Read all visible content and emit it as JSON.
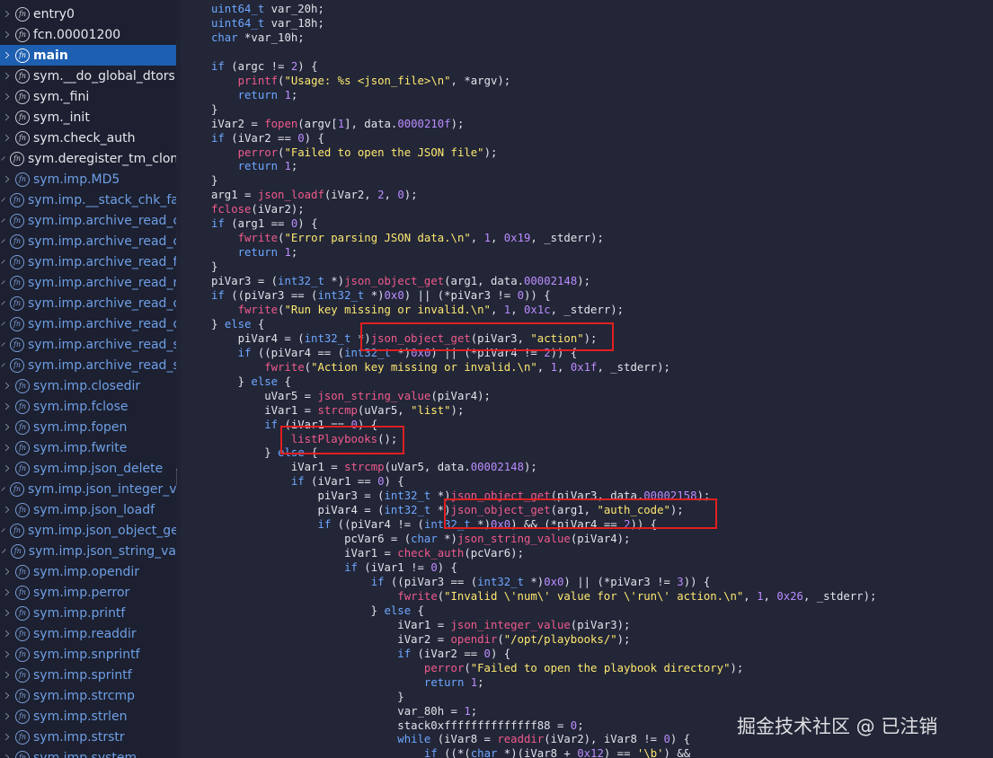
{
  "sidebar": {
    "items": [
      {
        "label": "entry0",
        "imported": false,
        "selected": false
      },
      {
        "label": "fcn.00001200",
        "imported": false,
        "selected": false
      },
      {
        "label": "main",
        "imported": false,
        "selected": true
      },
      {
        "label": "sym.__do_global_dtors",
        "imported": false,
        "selected": false
      },
      {
        "label": "sym._fini",
        "imported": false,
        "selected": false
      },
      {
        "label": "sym._init",
        "imported": false,
        "selected": false
      },
      {
        "label": "sym.check_auth",
        "imported": false,
        "selected": false
      },
      {
        "label": "sym.deregister_tm_clon",
        "imported": false,
        "selected": false
      },
      {
        "label": "sym.imp.MD5",
        "imported": true,
        "selected": false
      },
      {
        "label": "sym.imp.__stack_chk_fa",
        "imported": true,
        "selected": false
      },
      {
        "label": "sym.imp.archive_read_c",
        "imported": true,
        "selected": false
      },
      {
        "label": "sym.imp.archive_read_c",
        "imported": true,
        "selected": false
      },
      {
        "label": "sym.imp.archive_read_f",
        "imported": true,
        "selected": false
      },
      {
        "label": "sym.imp.archive_read_n",
        "imported": true,
        "selected": false
      },
      {
        "label": "sym.imp.archive_read_o",
        "imported": true,
        "selected": false
      },
      {
        "label": "sym.imp.archive_read_d",
        "imported": true,
        "selected": false
      },
      {
        "label": "sym.imp.archive_read_s",
        "imported": true,
        "selected": false
      },
      {
        "label": "sym.imp.archive_read_s",
        "imported": true,
        "selected": false
      },
      {
        "label": "sym.imp.closedir",
        "imported": true,
        "selected": false
      },
      {
        "label": "sym.imp.fclose",
        "imported": true,
        "selected": false
      },
      {
        "label": "sym.imp.fopen",
        "imported": true,
        "selected": false
      },
      {
        "label": "sym.imp.fwrite",
        "imported": true,
        "selected": false
      },
      {
        "label": "sym.imp.json_delete",
        "imported": true,
        "selected": false
      },
      {
        "label": "sym.imp.json_integer_v",
        "imported": true,
        "selected": false
      },
      {
        "label": "sym.imp.json_loadf",
        "imported": true,
        "selected": false
      },
      {
        "label": "sym.imp.json_object_ge",
        "imported": true,
        "selected": false
      },
      {
        "label": "sym.imp.json_string_va",
        "imported": true,
        "selected": false
      },
      {
        "label": "sym.imp.opendir",
        "imported": true,
        "selected": false
      },
      {
        "label": "sym.imp.perror",
        "imported": true,
        "selected": false
      },
      {
        "label": "sym.imp.printf",
        "imported": true,
        "selected": false
      },
      {
        "label": "sym.imp.readdir",
        "imported": true,
        "selected": false
      },
      {
        "label": "sym.imp.snprintf",
        "imported": true,
        "selected": false
      },
      {
        "label": "sym.imp.sprintf",
        "imported": true,
        "selected": false
      },
      {
        "label": "sym.imp.strcmp",
        "imported": true,
        "selected": false
      },
      {
        "label": "sym.imp.strlen",
        "imported": true,
        "selected": false
      },
      {
        "label": "sym.imp.strstr",
        "imported": true,
        "selected": false
      },
      {
        "label": "sym.imp.system",
        "imported": true,
        "selected": false
      }
    ]
  },
  "code": {
    "lines": [
      [
        [
          "uint64_t",
          "dt"
        ],
        [
          " var_20h;",
          ""
        ]
      ],
      [
        [
          "uint64_t",
          "dt"
        ],
        [
          " var_18h;",
          ""
        ]
      ],
      [
        [
          "char",
          "dt"
        ],
        [
          " *var_10h;",
          ""
        ]
      ],
      [],
      [
        [
          "if",
          "kw"
        ],
        [
          " (argc != ",
          ""
        ],
        [
          "2",
          "num"
        ],
        [
          ") {",
          ""
        ]
      ],
      [
        [
          "    ",
          ""
        ],
        [
          "printf",
          "fn"
        ],
        [
          "(",
          ""
        ],
        [
          "\"Usage: %s <json_file>\\n\"",
          "str"
        ],
        [
          ", *argv);",
          ""
        ]
      ],
      [
        [
          "    ",
          ""
        ],
        [
          "return",
          "kw"
        ],
        [
          " ",
          ""
        ],
        [
          "1",
          "num"
        ],
        [
          ";",
          ""
        ]
      ],
      [
        [
          "}",
          ""
        ]
      ],
      [
        [
          "iVar2 = ",
          ""
        ],
        [
          "fopen",
          "fn"
        ],
        [
          "(argv[",
          ""
        ],
        [
          "1",
          "num"
        ],
        [
          "], data.",
          ""
        ],
        [
          "0000210f",
          "num"
        ],
        [
          ");",
          ""
        ]
      ],
      [
        [
          "if",
          "kw"
        ],
        [
          " (iVar2 == ",
          ""
        ],
        [
          "0",
          "num"
        ],
        [
          ") {",
          ""
        ]
      ],
      [
        [
          "    ",
          ""
        ],
        [
          "perror",
          "fn"
        ],
        [
          "(",
          ""
        ],
        [
          "\"Failed to open the JSON file\"",
          "str"
        ],
        [
          ");",
          ""
        ]
      ],
      [
        [
          "    ",
          ""
        ],
        [
          "return",
          "kw"
        ],
        [
          " ",
          ""
        ],
        [
          "1",
          "num"
        ],
        [
          ";",
          ""
        ]
      ],
      [
        [
          "}",
          ""
        ]
      ],
      [
        [
          "arg1 = ",
          ""
        ],
        [
          "json_loadf",
          "fn"
        ],
        [
          "(iVar2, ",
          ""
        ],
        [
          "2",
          "num"
        ],
        [
          ", ",
          ""
        ],
        [
          "0",
          "num"
        ],
        [
          ");",
          ""
        ]
      ],
      [
        [
          "fclose",
          "fn"
        ],
        [
          "(iVar2);",
          ""
        ]
      ],
      [
        [
          "if",
          "kw"
        ],
        [
          " (arg1 == ",
          ""
        ],
        [
          "0",
          "num"
        ],
        [
          ") {",
          ""
        ]
      ],
      [
        [
          "    ",
          ""
        ],
        [
          "fwrite",
          "fn"
        ],
        [
          "(",
          ""
        ],
        [
          "\"Error parsing JSON data.\\n\"",
          "str"
        ],
        [
          ", ",
          ""
        ],
        [
          "1",
          "num"
        ],
        [
          ", ",
          ""
        ],
        [
          "0x19",
          "num"
        ],
        [
          ", _stderr);",
          ""
        ]
      ],
      [
        [
          "    ",
          ""
        ],
        [
          "return",
          "kw"
        ],
        [
          " ",
          ""
        ],
        [
          "1",
          "num"
        ],
        [
          ";",
          ""
        ]
      ],
      [
        [
          "}",
          ""
        ]
      ],
      [
        [
          "piVar3 = (",
          ""
        ],
        [
          "int32_t",
          "dt"
        ],
        [
          " *)",
          ""
        ],
        [
          "json_object_get",
          "fn"
        ],
        [
          "(arg1, data.",
          ""
        ],
        [
          "00002148",
          "num"
        ],
        [
          ");",
          ""
        ]
      ],
      [
        [
          "if",
          "kw"
        ],
        [
          " ((piVar3 == (",
          ""
        ],
        [
          "int32_t",
          "dt"
        ],
        [
          " *)",
          ""
        ],
        [
          "0x0",
          "num"
        ],
        [
          ") || (*piVar3 != ",
          ""
        ],
        [
          "0",
          "num"
        ],
        [
          ")) {",
          ""
        ]
      ],
      [
        [
          "    ",
          ""
        ],
        [
          "fwrite",
          "fn"
        ],
        [
          "(",
          ""
        ],
        [
          "\"Run key missing or invalid.\\n\"",
          "str"
        ],
        [
          ", ",
          ""
        ],
        [
          "1",
          "num"
        ],
        [
          ", ",
          ""
        ],
        [
          "0x1c",
          "num"
        ],
        [
          ", _stderr);",
          ""
        ]
      ],
      [
        [
          "} ",
          ""
        ],
        [
          "else",
          "kw"
        ],
        [
          " {",
          ""
        ]
      ],
      [
        [
          "    piVar4 = (",
          ""
        ],
        [
          "int32_t",
          "dt"
        ],
        [
          " *)",
          ""
        ],
        [
          "json_object_get",
          "fn"
        ],
        [
          "(piVar3, ",
          ""
        ],
        [
          "\"action\"",
          "str"
        ],
        [
          ");",
          ""
        ]
      ],
      [
        [
          "    ",
          ""
        ],
        [
          "if",
          "kw"
        ],
        [
          " ((piVar4 == (",
          ""
        ],
        [
          "int32_t",
          "dt"
        ],
        [
          " *)",
          ""
        ],
        [
          "0x0",
          "num"
        ],
        [
          ") || (*piVar4 != ",
          ""
        ],
        [
          "2",
          "num"
        ],
        [
          ")) {",
          ""
        ]
      ],
      [
        [
          "        ",
          ""
        ],
        [
          "fwrite",
          "fn"
        ],
        [
          "(",
          ""
        ],
        [
          "\"Action key missing or invalid.\\n\"",
          "str"
        ],
        [
          ", ",
          ""
        ],
        [
          "1",
          "num"
        ],
        [
          ", ",
          ""
        ],
        [
          "0x1f",
          "num"
        ],
        [
          ", _stderr);",
          ""
        ]
      ],
      [
        [
          "    } ",
          ""
        ],
        [
          "else",
          "kw"
        ],
        [
          " {",
          ""
        ]
      ],
      [
        [
          "        uVar5 = ",
          ""
        ],
        [
          "json_string_value",
          "fn"
        ],
        [
          "(piVar4);",
          ""
        ]
      ],
      [
        [
          "        iVar1 = ",
          ""
        ],
        [
          "strcmp",
          "fn"
        ],
        [
          "(uVar5, ",
          ""
        ],
        [
          "\"list\"",
          "str"
        ],
        [
          ");",
          ""
        ]
      ],
      [
        [
          "        ",
          ""
        ],
        [
          "if",
          "kw"
        ],
        [
          " (iVar1 == ",
          ""
        ],
        [
          "0",
          "num"
        ],
        [
          ") {",
          ""
        ]
      ],
      [
        [
          "            ",
          ""
        ],
        [
          "listPlaybooks",
          "fn"
        ],
        [
          "();",
          ""
        ]
      ],
      [
        [
          "        } ",
          ""
        ],
        [
          "else",
          "kw"
        ],
        [
          " {",
          ""
        ]
      ],
      [
        [
          "            iVar1 = ",
          ""
        ],
        [
          "strcmp",
          "fn"
        ],
        [
          "(uVar5, data.",
          ""
        ],
        [
          "00002148",
          "num"
        ],
        [
          ");",
          ""
        ]
      ],
      [
        [
          "            ",
          ""
        ],
        [
          "if",
          "kw"
        ],
        [
          " (iVar1 == ",
          ""
        ],
        [
          "0",
          "num"
        ],
        [
          ") {",
          ""
        ]
      ],
      [
        [
          "                piVar3 = (",
          ""
        ],
        [
          "int32_t",
          "dt"
        ],
        [
          " *)",
          ""
        ],
        [
          "json_object_get",
          "fn"
        ],
        [
          "(piVar3, data.",
          ""
        ],
        [
          "00002158",
          "num"
        ],
        [
          ");",
          ""
        ]
      ],
      [
        [
          "                piVar4 = (",
          ""
        ],
        [
          "int32_t",
          "dt"
        ],
        [
          " *)",
          ""
        ],
        [
          "json_object_get",
          "fn"
        ],
        [
          "(arg1, ",
          ""
        ],
        [
          "\"auth_code\"",
          "str"
        ],
        [
          ");",
          ""
        ]
      ],
      [
        [
          "                ",
          ""
        ],
        [
          "if",
          "kw"
        ],
        [
          " ((piVar4 != (",
          ""
        ],
        [
          "int32_t",
          "dt"
        ],
        [
          " *)",
          ""
        ],
        [
          "0x0",
          "num"
        ],
        [
          ") && (*piVar4 == ",
          ""
        ],
        [
          "2",
          "num"
        ],
        [
          ")) {",
          ""
        ]
      ],
      [
        [
          "                    pcVar6 = (",
          ""
        ],
        [
          "char",
          "dt"
        ],
        [
          " *)",
          ""
        ],
        [
          "json_string_value",
          "fn"
        ],
        [
          "(piVar4);",
          ""
        ]
      ],
      [
        [
          "                    iVar1 = ",
          ""
        ],
        [
          "check_auth",
          "fn"
        ],
        [
          "(pcVar6);",
          ""
        ]
      ],
      [
        [
          "                    ",
          ""
        ],
        [
          "if",
          "kw"
        ],
        [
          " (iVar1 != ",
          ""
        ],
        [
          "0",
          "num"
        ],
        [
          ") {",
          ""
        ]
      ],
      [
        [
          "                        ",
          ""
        ],
        [
          "if",
          "kw"
        ],
        [
          " ((piVar3 == (",
          ""
        ],
        [
          "int32_t",
          "dt"
        ],
        [
          " *)",
          ""
        ],
        [
          "0x0",
          "num"
        ],
        [
          ") || (*piVar3 != ",
          ""
        ],
        [
          "3",
          "num"
        ],
        [
          ")) {",
          ""
        ]
      ],
      [
        [
          "                            ",
          ""
        ],
        [
          "fwrite",
          "fn"
        ],
        [
          "(",
          ""
        ],
        [
          "\"Invalid \\'num\\' value for \\'run\\' action.\\n\"",
          "str"
        ],
        [
          ", ",
          ""
        ],
        [
          "1",
          "num"
        ],
        [
          ", ",
          ""
        ],
        [
          "0x26",
          "num"
        ],
        [
          ", _stderr);",
          ""
        ]
      ],
      [
        [
          "                        } ",
          ""
        ],
        [
          "else",
          "kw"
        ],
        [
          " {",
          ""
        ]
      ],
      [
        [
          "                            iVar1 = ",
          ""
        ],
        [
          "json_integer_value",
          "fn"
        ],
        [
          "(piVar3);",
          ""
        ]
      ],
      [
        [
          "                            iVar2 = ",
          ""
        ],
        [
          "opendir",
          "fn"
        ],
        [
          "(",
          ""
        ],
        [
          "\"/opt/playbooks/\"",
          "str"
        ],
        [
          ");",
          ""
        ]
      ],
      [
        [
          "                            ",
          ""
        ],
        [
          "if",
          "kw"
        ],
        [
          " (iVar2 == ",
          ""
        ],
        [
          "0",
          "num"
        ],
        [
          ") {",
          ""
        ]
      ],
      [
        [
          "                                ",
          ""
        ],
        [
          "perror",
          "fn"
        ],
        [
          "(",
          ""
        ],
        [
          "\"Failed to open the playbook directory\"",
          "str"
        ],
        [
          ");",
          ""
        ]
      ],
      [
        [
          "                                ",
          ""
        ],
        [
          "return",
          "kw"
        ],
        [
          " ",
          ""
        ],
        [
          "1",
          "num"
        ],
        [
          ";",
          ""
        ]
      ],
      [
        [
          "                            }",
          ""
        ]
      ],
      [
        [
          "                            var_80h = ",
          ""
        ],
        [
          "1",
          "num"
        ],
        [
          ";",
          ""
        ]
      ],
      [
        [
          "                            stack0xffffffffffffff88 = ",
          ""
        ],
        [
          "0",
          "num"
        ],
        [
          ";",
          ""
        ]
      ],
      [
        [
          "                            ",
          ""
        ],
        [
          "while",
          "kw"
        ],
        [
          " (iVar8 = ",
          ""
        ],
        [
          "readdir",
          "fn"
        ],
        [
          "(iVar2), iVar8 != ",
          ""
        ],
        [
          "0",
          "num"
        ],
        [
          ") {",
          ""
        ]
      ],
      [
        [
          "                                ",
          ""
        ],
        [
          "if",
          "kw"
        ],
        [
          " ((*(",
          ""
        ],
        [
          "char",
          "dt"
        ],
        [
          " *)(iVar8 + ",
          ""
        ],
        [
          "0x12",
          "num"
        ],
        [
          ") == ",
          ""
        ],
        [
          "'\\b'",
          "str"
        ],
        [
          ") &&",
          ""
        ]
      ]
    ]
  },
  "watermark": "掘金技术社区 @ 已注销"
}
